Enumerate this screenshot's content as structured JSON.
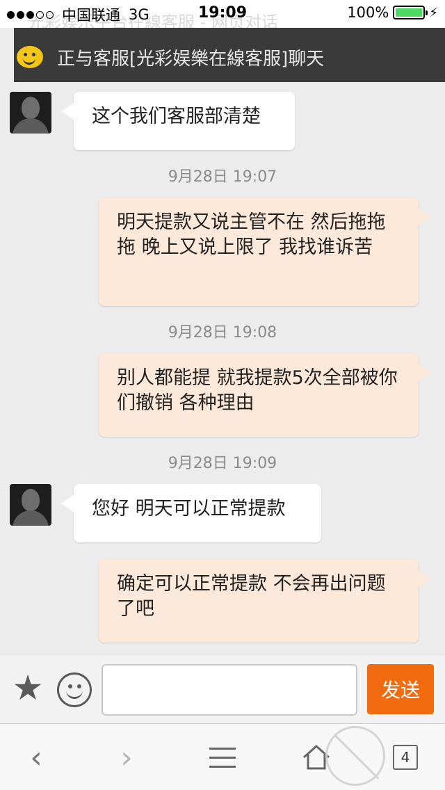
{
  "status_bar": {
    "carrier": "中国联通",
    "network": "3G",
    "time": "19:09",
    "battery": "100%",
    "battery_level": 1.0,
    "signal_bars": 3
  },
  "page_title": "光彩娱乐平台在線客服 - 网页对话",
  "header": {
    "title": "正与客服[光彩娱樂在線客服]聊天"
  },
  "messages": [
    {
      "side": "left",
      "text": "这个我们客服部清楚"
    },
    {
      "side": "time",
      "text": "9月28日  19:07"
    },
    {
      "side": "right",
      "text": "明天提款又说主管不在 然后拖拖拖 晚上又说上限了 我找谁诉苦"
    },
    {
      "side": "time",
      "text": "9月28日  19:08"
    },
    {
      "side": "right",
      "text": "别人都能提 就我提款5次全部被你们撤销 各种理由"
    },
    {
      "side": "time",
      "text": "9月28日  19:09"
    },
    {
      "side": "left",
      "text": "您好 明天可以正常提款"
    },
    {
      "side": "right",
      "text": "确定可以正常提款 不会再出问题了吧"
    }
  ],
  "input": {
    "value": "",
    "send_label": "发送"
  },
  "toolbar": {
    "tab_count": "4"
  },
  "colors": {
    "send_button": "#f26b0f",
    "right_bubble": "#fde9d9",
    "header_bg": "#3a3a3a",
    "battery": "#4cd964"
  }
}
